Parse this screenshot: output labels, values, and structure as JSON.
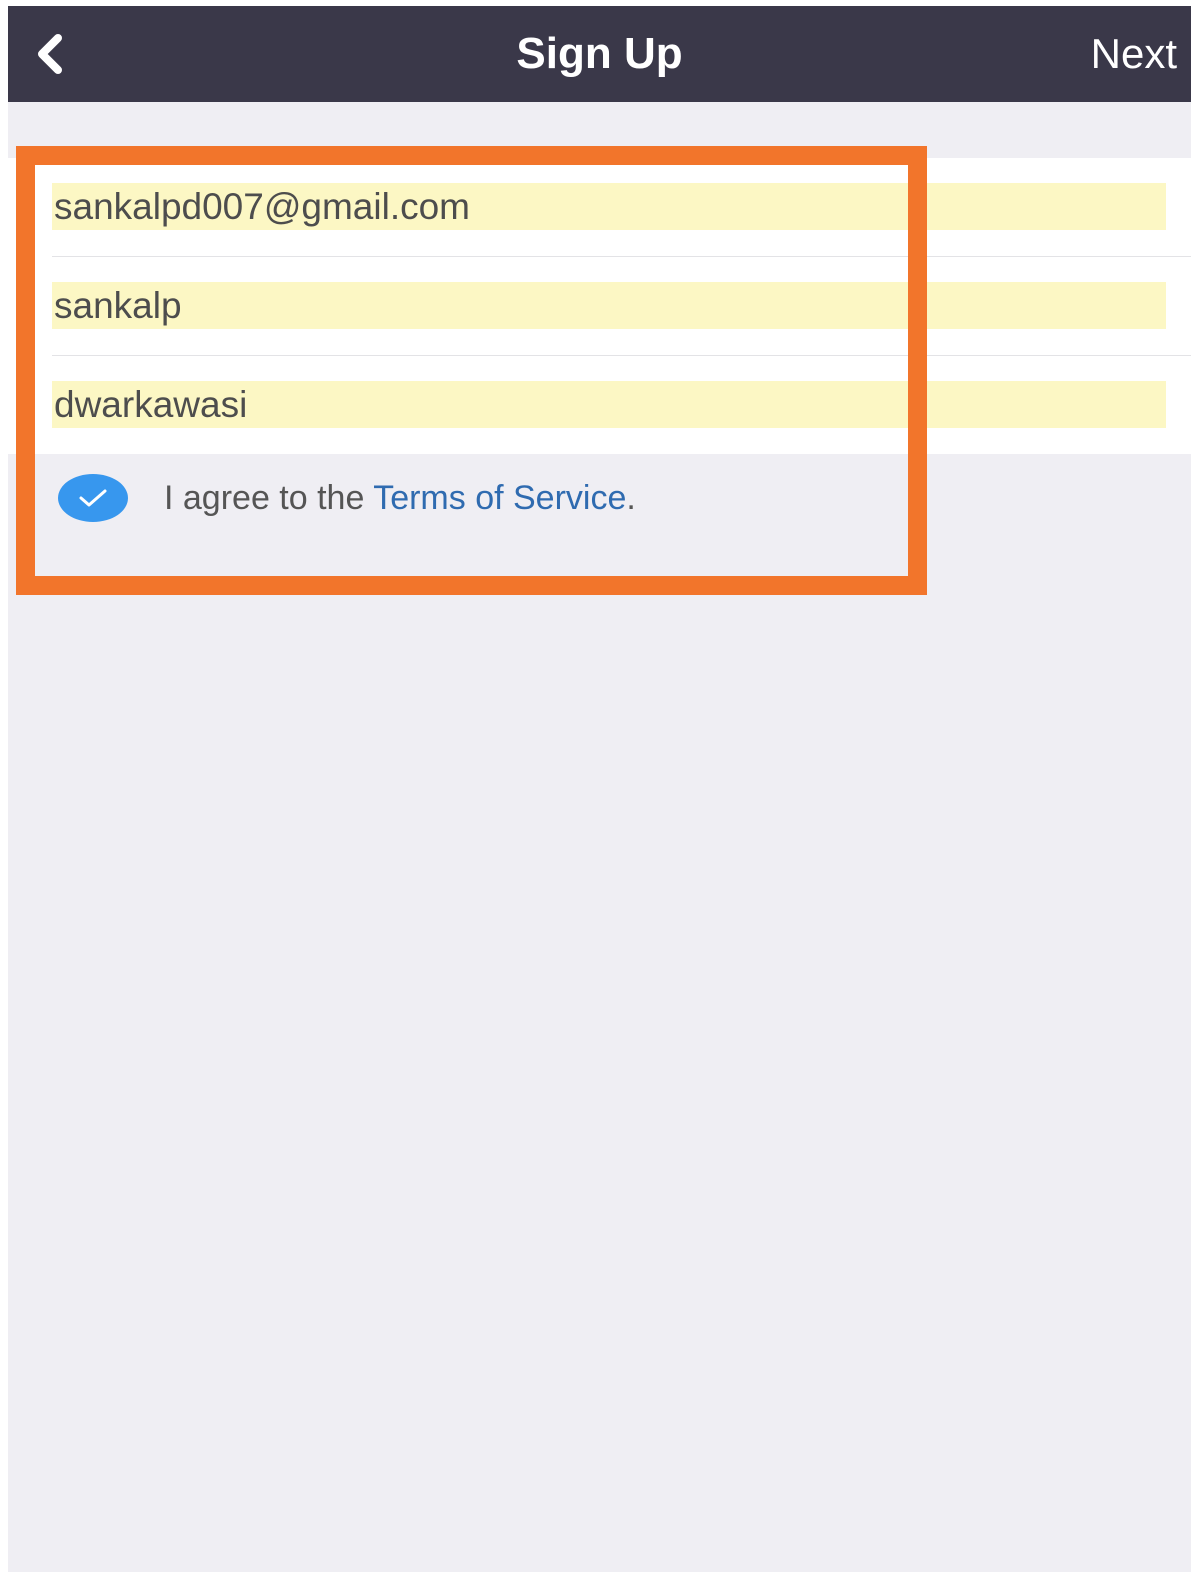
{
  "navbar": {
    "title": "Sign Up",
    "back_icon": "chevron-left-icon",
    "next_label": "Next"
  },
  "form": {
    "email_value": "sankalpd007@gmail.com",
    "first_name_value": "sankalp",
    "last_name_value": "dwarkawasi"
  },
  "terms": {
    "checked": true,
    "checkbox_icon": "checkmark-icon",
    "prefix": "I agree to the ",
    "link_label": "Terms of Service",
    "suffix": "."
  },
  "colors": {
    "navbar_bg": "#3a3849",
    "screen_bg": "#efeef3",
    "autofill_highlight": "#fcf7c4",
    "checkbox_blue": "#3797ee",
    "link_blue": "#2f6bb0",
    "annotation_orange": "#f2752b"
  }
}
